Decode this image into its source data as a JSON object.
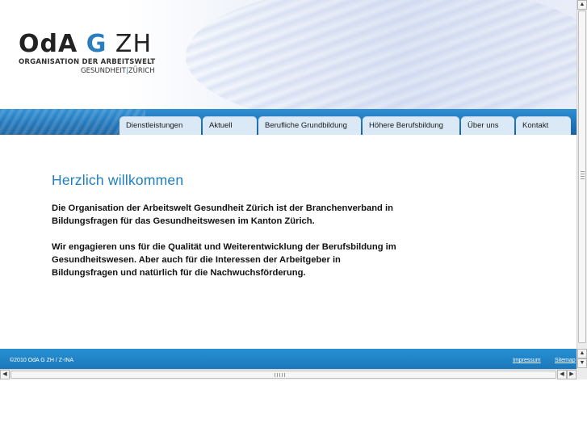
{
  "logo": {
    "part1": "OdA",
    "part2": "G",
    "part3": "ZH",
    "line1": "ORGANISATION DER ARBEITSWELT",
    "line2a": "GESUNDHEIT",
    "line2sep": "|",
    "line2b": "ZÜRICH"
  },
  "nav": {
    "items": [
      {
        "label": "Dienstleistungen"
      },
      {
        "label": "Aktuell"
      },
      {
        "label": "Berufliche Grundbildung"
      },
      {
        "label": "Höhere Berufsbildung"
      },
      {
        "label": "Über uns"
      },
      {
        "label": "Kontakt"
      }
    ]
  },
  "main": {
    "title": "Herzlich willkommen",
    "para1": "Die Organisation der Arbeitswelt Gesundheit Zürich ist der Branchenverband in Bildungsfragen für das Gesundheitswesen im Kanton Zürich.",
    "para2": "Wir engagieren uns für die Qualität und Weiterentwicklung der Berufsbildung im Gesundheitswesen. Aber auch für die Interessen der Arbeitgeber in Bildungsfragen und natürlich für die Nachwuchsförderung."
  },
  "footer": {
    "copyright": "©2010 OdA G ZH / Z-INA",
    "impressum": "Impressum",
    "sitemap": "Sitemap"
  },
  "scroll": {
    "up": "▲",
    "down": "▼",
    "left": "◀",
    "right": "▶"
  }
}
